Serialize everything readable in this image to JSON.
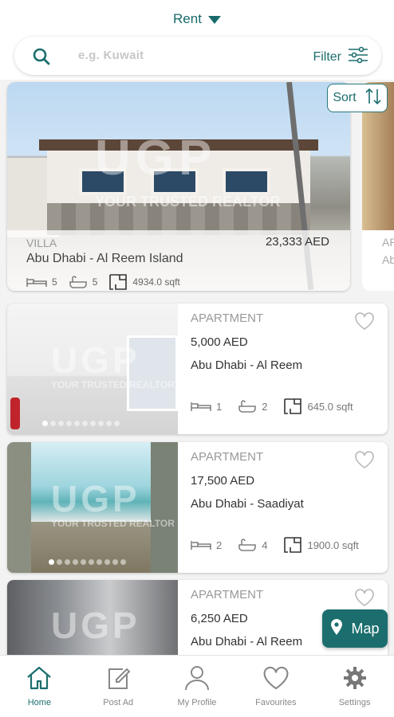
{
  "header": {
    "mode_label": "Rent",
    "search_placeholder": "e.g. Kuwait",
    "filter_label": "Filter"
  },
  "sort_label": "Sort",
  "featured": {
    "type": "VILLA",
    "price": "23,333 AED",
    "location": "Abu Dhabi - Al Reem Island",
    "beds": "5",
    "baths": "5",
    "area": "4934.0 sqft",
    "watermark": "UGP",
    "watermark_tag": "YOUR TRUSTED REALTOR",
    "peek_lines": [
      "AP",
      "Ab"
    ]
  },
  "listings": [
    {
      "type": "APARTMENT",
      "price": "5,000 AED",
      "location": "Abu Dhabi - Al Reem",
      "beds": "1",
      "baths": "2",
      "area": "645.0 sqft",
      "watermark": "UGP",
      "watermark_tag": "YOUR TRUSTED REALTOR",
      "photo_count": 10,
      "active_photo": 1
    },
    {
      "type": "APARTMENT",
      "price": "17,500 AED",
      "location": "Abu Dhabi - Saadiyat",
      "beds": "2",
      "baths": "4",
      "area": "1900.0 sqft",
      "watermark": "UGP",
      "watermark_tag": "YOUR TRUSTED REALTOR",
      "photo_count": 10,
      "active_photo": 1
    },
    {
      "type": "APARTMENT",
      "price": "6,250 AED",
      "location": "Abu Dhabi - Al Reem",
      "watermark": "UGP"
    }
  ],
  "map_label": "Map",
  "bottom_nav": [
    {
      "label": "Home",
      "icon": "home-icon",
      "active": true
    },
    {
      "label": "Post Ad",
      "icon": "edit-icon",
      "active": false
    },
    {
      "label": "My Profile",
      "icon": "user-icon",
      "active": false
    },
    {
      "label": "Favourites",
      "icon": "heart-icon",
      "active": false
    },
    {
      "label": "Settings",
      "icon": "gear-icon",
      "active": false
    }
  ],
  "colors": {
    "accent": "#1c6e6e",
    "text": "#333333",
    "muted": "#999999"
  }
}
